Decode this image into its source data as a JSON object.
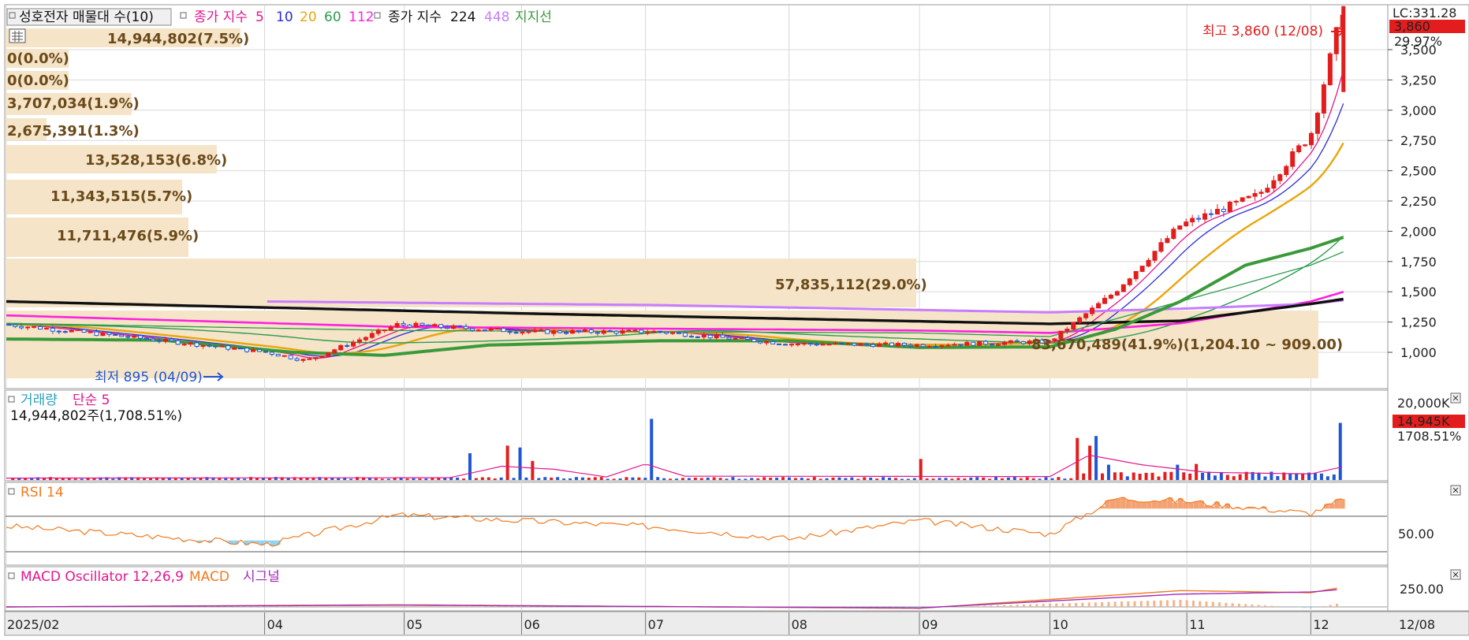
{
  "colors": {
    "up": "#e31d1d",
    "down": "#1f56d6",
    "ma5": "#e2158f",
    "ma10": "#2b2bd9",
    "ma20": "#e9a50c",
    "ma60": "#2a9c4f",
    "ma112": "#ff20e0",
    "ma224": "#101010",
    "ma448": "#c77dff",
    "support": "#3a9a3a",
    "volume_profile": "#f5e4c8",
    "rsi": "#f07a20",
    "rsi_fill": "#f3a373",
    "rsi_low_fill": "#8fd3f0",
    "macd": "#f07a20",
    "signal": "#a22ab8",
    "grid": "#d8d8d8",
    "badge": "#e31d1d"
  },
  "legend": {
    "title": "성호전자 매물대 수(10)",
    "ma_prefix": "종가 지수",
    "ma_periods": [
      "5",
      "10",
      "20",
      "60",
      "112"
    ],
    "ma2_prefix": "종가 지수",
    "ma2_periods": [
      "224",
      "448"
    ],
    "support_label": "지지선"
  },
  "price_labels": {
    "high": "최고 3,860 (12/08)",
    "low": "최저 895 (04/09)",
    "lc": "LC:331.28",
    "last": "3,860",
    "change": "29.97%"
  },
  "price_axis": {
    "ticks": [
      "3,500",
      "3,250",
      "3,000",
      "2,750",
      "2,500",
      "2,250",
      "2,000",
      "1,750",
      "1,500",
      "1,250",
      "1,000"
    ]
  },
  "volume_profile_labels": [
    "14,944,802(7.5%)",
    "0(0.0%)",
    "0(0.0%)",
    "3,707,034(1.9%)",
    "2,675,391(1.3%)",
    "13,528,153(6.8%)",
    "11,343,515(5.7%)",
    "11,711,476(5.9%)",
    "57,835,112(29.0%)",
    "83,670,489(41.9%)(1,204.10 ~ 909.00)"
  ],
  "volume_panel": {
    "title": "거래량",
    "ma_label": "단순 5",
    "current": "14,944,802주(1,708.51%)",
    "axis_top": "20,000K",
    "badge": "14,945K",
    "badge_pct": "1708.51%"
  },
  "rsi_panel": {
    "title": "RSI 14",
    "tick": "50.00"
  },
  "macd_panel": {
    "title": "MACD Oscillator 12,26,9",
    "macd_label": "MACD",
    "signal_label": "시그널",
    "tick": "250.00"
  },
  "x_axis": {
    "labels": [
      "2025/02",
      "04",
      "05",
      "06",
      "07",
      "08",
      "09",
      "10",
      "11",
      "12"
    ],
    "right_label": "12/08"
  },
  "chart_data": [
    {
      "type": "candlestick",
      "title": "성호전자 매물대 수(10)",
      "ylim": [
        850,
        3650
      ],
      "x_period": "2025/02 - 2025/12",
      "series_summary": {
        "start_close": 1230,
        "low": {
          "value": 895,
          "date": "04/09"
        },
        "high": {
          "value": 3860,
          "date": "12/08"
        },
        "last_close": 3860
      },
      "key_points": [
        {
          "x": "2025/02",
          "close": 1230
        },
        {
          "x": "03",
          "close": 1120
        },
        {
          "x": "04",
          "close": 1000
        },
        {
          "x": "04/09",
          "close": 930
        },
        {
          "x": "05",
          "close": 1230
        },
        {
          "x": "06",
          "close": 1170
        },
        {
          "x": "07",
          "close": 1170
        },
        {
          "x": "08",
          "close": 1070
        },
        {
          "x": "09",
          "close": 1060
        },
        {
          "x": "10",
          "close": 1090
        },
        {
          "x": "10 mid",
          "close": 1500
        },
        {
          "x": "11",
          "close": 2050
        },
        {
          "x": "11 late",
          "close": 2300
        },
        {
          "x": "12",
          "close": 2800
        },
        {
          "x": "12/08",
          "close": 3860
        }
      ]
    },
    {
      "type": "bar",
      "title": "거래량",
      "unit": "K",
      "ylim": [
        0,
        20000
      ],
      "spikes": [
        {
          "x": "04 late",
          "value": 7000
        },
        {
          "x": "05",
          "value": 9000
        },
        {
          "x": "06",
          "value": 16000
        },
        {
          "x": "09",
          "value": 5500
        },
        {
          "x": "10",
          "value": 11500
        },
        {
          "x": "12/08",
          "value": 14945
        }
      ]
    },
    {
      "type": "line",
      "title": "RSI 14",
      "ylim": [
        0,
        100
      ],
      "reference": 50,
      "key_points": [
        {
          "x": "2025/02",
          "value": 48
        },
        {
          "x": "04",
          "value": 25
        },
        {
          "x": "05",
          "value": 62
        },
        {
          "x": "07",
          "value": 47
        },
        {
          "x": "08",
          "value": 32
        },
        {
          "x": "09",
          "value": 55
        },
        {
          "x": "10",
          "value": 38
        },
        {
          "x": "10 mid",
          "value": 83
        },
        {
          "x": "11",
          "value": 80
        },
        {
          "x": "12",
          "value": 64
        },
        {
          "x": "12/08",
          "value": 82
        }
      ]
    },
    {
      "type": "line",
      "title": "MACD Oscillator 12,26,9",
      "series_names": [
        "MACD",
        "시그널"
      ],
      "tick": 250,
      "key_points": [
        {
          "x": "2025/02",
          "macd": 0,
          "signal": 0
        },
        {
          "x": "05",
          "macd": 30,
          "signal": 25
        },
        {
          "x": "09",
          "macd": -20,
          "signal": -15
        },
        {
          "x": "11",
          "macd": 230,
          "signal": 180
        },
        {
          "x": "12",
          "macd": 200,
          "signal": 210
        },
        {
          "x": "12/08",
          "macd": 280,
          "signal": 250
        }
      ]
    }
  ]
}
